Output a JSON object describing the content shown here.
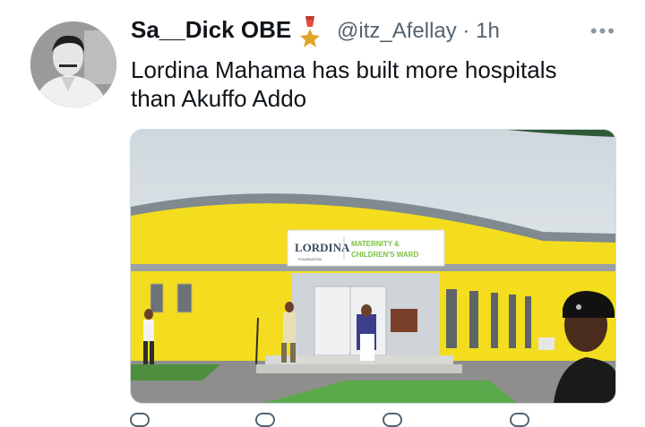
{
  "tweet": {
    "display_name": "Sa__Dick OBE",
    "handle": "@itz_Afellay",
    "separator": "·",
    "time": "1h",
    "more_label": "•••",
    "text": "Lordina Mahama has built more hospitals than Akuffo Addo"
  },
  "media": {
    "sign_brand": "LORDINA",
    "sign_sub": "FOUNDATION",
    "sign_line1": "MATERNITY &",
    "sign_line2": "CHILDREN'S WARD"
  },
  "actions": {
    "reply_icon": "reply-icon",
    "retweet_icon": "retweet-icon",
    "like_icon": "heart-icon",
    "share_icon": "share-icon"
  },
  "colors": {
    "text": "#0f1419",
    "secondary": "#536471",
    "building_yellow": "#f3dd1e",
    "sign_green": "#7bc043"
  }
}
